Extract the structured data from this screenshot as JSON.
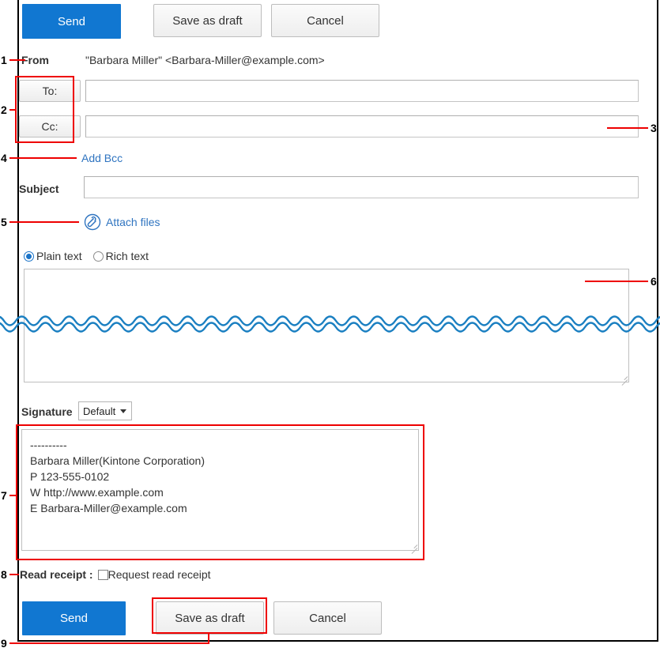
{
  "toolbar_top": {
    "send_label": "Send",
    "save_draft_label": "Save as draft",
    "cancel_label": "Cancel"
  },
  "toolbar_bottom": {
    "send_label": "Send",
    "save_draft_label": "Save as draft",
    "cancel_label": "Cancel"
  },
  "form": {
    "from_label": "From",
    "from_value": "\"Barbara Miller\" <Barbara-Miller@example.com>",
    "to_button_label": "To:",
    "to_value": "",
    "cc_button_label": "Cc:",
    "cc_value": "",
    "add_bcc_label": "Add Bcc",
    "subject_label": "Subject",
    "subject_value": "",
    "attach_files_label": "Attach files",
    "plain_text_label": "Plain text",
    "rich_text_label": "Rich text",
    "body_value": "",
    "signature_label": "Signature",
    "signature_select_value": "Default",
    "signature_value": "----------\nBarbara Miller(Kintone Corporation)\nP 123-555-0102\nW http://www.example.com\nE Barbara-Miller@example.com",
    "read_receipt_label": "Read receipt :",
    "read_receipt_checkbox_label": "Request read receipt"
  },
  "annotations": {
    "n1": "1",
    "n2": "2",
    "n3": "3",
    "n4": "4",
    "n5": "5",
    "n6": "6",
    "n7": "7",
    "n8": "8",
    "n9": "9"
  },
  "colors": {
    "primary_blue": "#1177d1",
    "link_blue": "#2f74c0",
    "annotation_red": "#ee0000",
    "squiggle_blue": "#1a7fc1",
    "border_gray": "#c4c4c4"
  }
}
